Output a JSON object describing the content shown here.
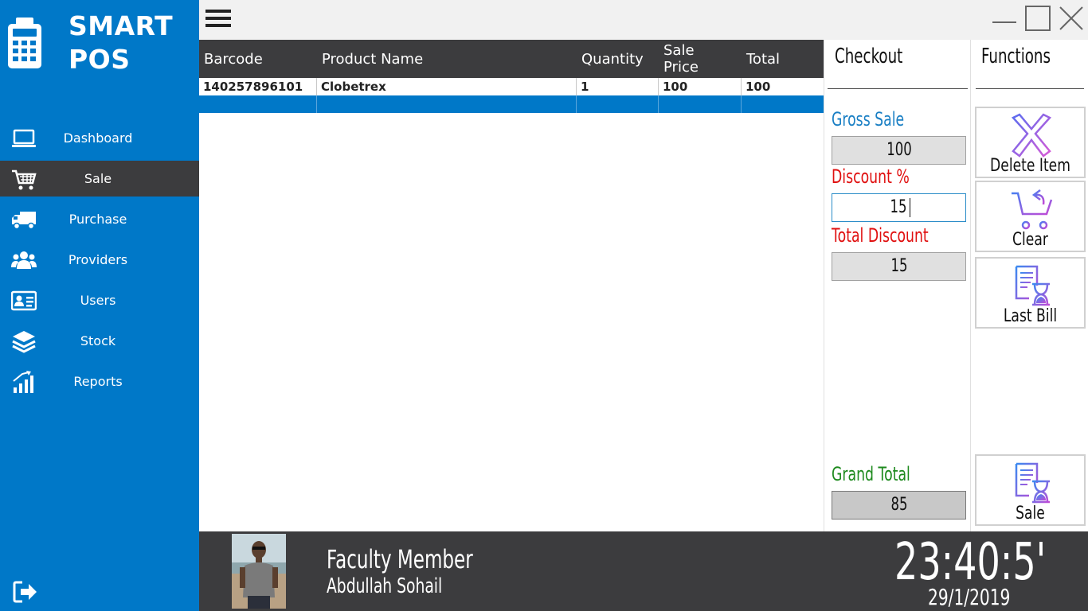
{
  "app": {
    "title_line1": "SMART",
    "title_line2": "POS"
  },
  "sidebar": {
    "items": [
      {
        "label": "Dashboard",
        "icon": "laptop-icon"
      },
      {
        "label": "Sale",
        "icon": "cart-icon",
        "active": true
      },
      {
        "label": "Purchase",
        "icon": "truck-icon"
      },
      {
        "label": "Providers",
        "icon": "users-group-icon"
      },
      {
        "label": "Users",
        "icon": "id-card-icon"
      },
      {
        "label": "Stock",
        "icon": "layers-icon"
      },
      {
        "label": "Reports",
        "icon": "bar-chart-icon"
      }
    ],
    "logout_icon": "logout-icon"
  },
  "grid": {
    "columns": [
      "Barcode",
      "Product Name",
      "Quantity",
      "Sale Price",
      "Total"
    ],
    "rows": [
      [
        "140257896101",
        "Clobetrex",
        "1",
        "100",
        "100"
      ]
    ]
  },
  "checkout": {
    "title": "Checkout",
    "gross_sale_label": "Gross Sale",
    "gross_sale_value": "100",
    "discount_label": "Discount %",
    "discount_value": "15",
    "total_discount_label": "Total Discount",
    "total_discount_value": "15",
    "grand_total_label": "Grand Total",
    "grand_total_value": "85"
  },
  "functions": {
    "title": "Functions",
    "buttons": [
      {
        "label": "Delete Item",
        "icon": "delete-x-icon"
      },
      {
        "label": "Clear",
        "icon": "cart-clear-icon"
      },
      {
        "label": "Last Bill",
        "icon": "bill-hourglass-icon"
      },
      {
        "label": "Sale",
        "icon": "sale-receipt-icon"
      }
    ]
  },
  "footer": {
    "role": "Faculty Member",
    "name": "Abdullah Sohail",
    "time": "23:40:5'",
    "date": "29/1/2019"
  },
  "colors": {
    "sidebar": "#0078c8",
    "dark": "#3c3c3e",
    "gross_sale_label": "#1a7fc4",
    "discount_label": "#e01010",
    "grand_total_label": "#1e8a1e"
  }
}
